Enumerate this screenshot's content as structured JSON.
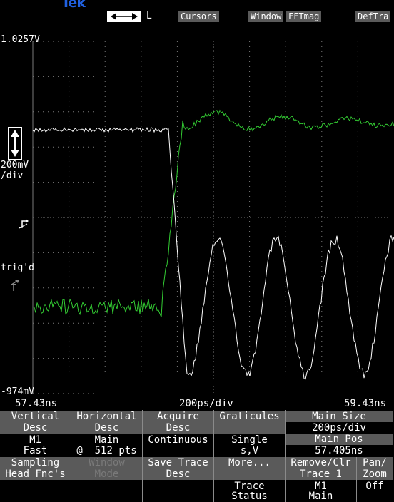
{
  "header": {
    "logo": "Tek",
    "cursor_mode_label": "L",
    "tabs": [
      "Cursors",
      "Window",
      "FFTmag",
      "DefTra"
    ]
  },
  "scope": {
    "top_level": "1.0257V",
    "bottom_level": "-974mV",
    "vertical_scale_value": "200mV",
    "vertical_scale_unit": "/div",
    "trigger_status": "trig'd",
    "trigger_marker": "T",
    "time_start": "57.43ns",
    "time_scale": "200ps/div",
    "time_end": "59.43ns",
    "colors": {
      "green_trace": "#33cc33",
      "white_trace": "#ffffff",
      "grid": "#7a7a7a",
      "tab_bg": "#5a5a5a"
    }
  },
  "menu": {
    "row1": [
      {
        "title": "Vertical",
        "sub": "Desc",
        "value1": "M1",
        "value2": "Fast"
      },
      {
        "title": "Horizontal",
        "sub": "Desc",
        "value1": "Main",
        "value2": "@  512 pts"
      },
      {
        "title": "Acquire",
        "sub": "Desc",
        "value1": "Continuous",
        "value2": ""
      },
      {
        "title": "Graticules",
        "sub": "",
        "value1": "Single",
        "value2": "s,V"
      },
      {
        "title": "Main Size",
        "sub": "200ps/div",
        "value1": "Main Pos",
        "value2": "57.405ns"
      }
    ],
    "row2": [
      {
        "title": "Sampling",
        "sub": "Head Fnc's",
        "value1": "",
        "value2": ""
      },
      {
        "title": "Window",
        "sub": "Mode",
        "value1": "",
        "value2": ""
      },
      {
        "title": "Save Trace",
        "sub": "Desc",
        "value1": "",
        "value2": ""
      },
      {
        "title": "More...",
        "sub": "",
        "value1": "Trace",
        "value2": "Status"
      },
      {
        "title": "Remove/Clr",
        "sub": "Trace 1",
        "value1": "M1",
        "value2": "Main"
      }
    ],
    "pan_zoom": {
      "title1": "Pan/",
      "title2": "Zoom",
      "value": "Off"
    }
  }
}
